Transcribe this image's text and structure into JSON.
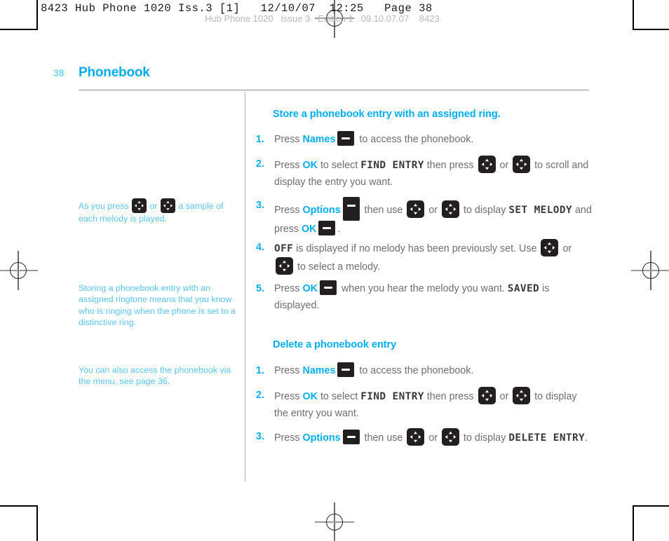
{
  "imposition": {
    "slug": "8423 Hub Phone 1020 Iss.3 [1]   12/10/07  12:25   Page 38",
    "slug_faint": "Hub Phone 1020   Issue 3   Edition 1   09.10.07.07    8423"
  },
  "header": {
    "page_number": "38",
    "title": "Phonebook"
  },
  "sidebar": {
    "notes": [
      {
        "before": "As you press ",
        "icon_a": "nav-key-icon",
        "mid": " or ",
        "icon_b": "nav-key-icon",
        "after": " a sample of each melody is played."
      },
      {
        "text": "Storing a phonebook entry with an assigned ringtone means that you know who is ringing when the phone is set to a distinctive ring."
      },
      {
        "text": "You can also access the phonebook via the menu, see page 36."
      }
    ]
  },
  "main": {
    "sections": [
      {
        "heading": "Store a phonebook entry with an assigned ring.",
        "steps": [
          {
            "num": "1.",
            "parts": [
              {
                "type": "text",
                "value": "Press "
              },
              {
                "type": "blue",
                "value": "Names"
              },
              {
                "type": "key",
                "value": "soft-key-icon"
              },
              {
                "type": "text",
                "value": " to access the phonebook."
              }
            ]
          },
          {
            "num": "2.",
            "parts": [
              {
                "type": "text",
                "value": "Press "
              },
              {
                "type": "blue",
                "value": "OK"
              },
              {
                "type": "text",
                "value": " to select "
              },
              {
                "type": "lcd",
                "value": "FIND ENTRY"
              },
              {
                "type": "text",
                "value": " then press "
              },
              {
                "type": "nav",
                "value": "nav-key-icon"
              },
              {
                "type": "text",
                "value": " or "
              },
              {
                "type": "nav",
                "value": "nav-key-icon"
              },
              {
                "type": "text",
                "value": " to scroll and display the entry you want."
              }
            ]
          },
          {
            "num": "3.",
            "parts": [
              {
                "type": "text",
                "value": "Press "
              },
              {
                "type": "blue",
                "value": "Options"
              },
              {
                "type": "key-tall",
                "value": "soft-key-icon"
              },
              {
                "type": "text",
                "value": " then use "
              },
              {
                "type": "nav",
                "value": "nav-key-icon"
              },
              {
                "type": "text",
                "value": " or "
              },
              {
                "type": "nav",
                "value": "nav-key-icon"
              },
              {
                "type": "text",
                "value": " to display "
              },
              {
                "type": "lcd",
                "value": "SET MELODY"
              },
              {
                "type": "text",
                "value": " and press "
              },
              {
                "type": "blue",
                "value": "OK"
              },
              {
                "type": "key",
                "value": "soft-key-icon"
              },
              {
                "type": "text",
                "value": "."
              }
            ]
          },
          {
            "num": "4.",
            "parts": [
              {
                "type": "lcd",
                "value": "OFF"
              },
              {
                "type": "text",
                "value": " is displayed if no melody has been previously set. Use "
              },
              {
                "type": "nav",
                "value": "nav-key-icon"
              },
              {
                "type": "text",
                "value": " or "
              },
              {
                "type": "nav",
                "value": "nav-key-icon"
              },
              {
                "type": "text",
                "value": " to select a melody."
              }
            ]
          },
          {
            "num": "5.",
            "parts": [
              {
                "type": "text",
                "value": "Press "
              },
              {
                "type": "blue",
                "value": "OK"
              },
              {
                "type": "key",
                "value": "soft-key-icon"
              },
              {
                "type": "text",
                "value": " when you hear the melody you want. "
              },
              {
                "type": "lcd",
                "value": "SAVED"
              },
              {
                "type": "text",
                "value": " is displayed."
              }
            ]
          }
        ]
      },
      {
        "heading": "Delete a phonebook entry",
        "steps": [
          {
            "num": "1.",
            "parts": [
              {
                "type": "text",
                "value": "Press "
              },
              {
                "type": "blue",
                "value": "Names"
              },
              {
                "type": "key",
                "value": "soft-key-icon"
              },
              {
                "type": "text",
                "value": " to access the phonebook."
              }
            ]
          },
          {
            "num": "2.",
            "parts": [
              {
                "type": "text",
                "value": "Press "
              },
              {
                "type": "blue",
                "value": "OK"
              },
              {
                "type": "text",
                "value": " to select "
              },
              {
                "type": "lcd",
                "value": "FIND ENTRY"
              },
              {
                "type": "text",
                "value": " then press "
              },
              {
                "type": "nav",
                "value": "nav-key-icon"
              },
              {
                "type": "text",
                "value": " or "
              },
              {
                "type": "nav",
                "value": "nav-key-icon"
              },
              {
                "type": "text",
                "value": " to display the entry you want."
              }
            ]
          },
          {
            "num": "3.",
            "parts": [
              {
                "type": "text",
                "value": "Press "
              },
              {
                "type": "blue",
                "value": "Options"
              },
              {
                "type": "key",
                "value": "soft-key-icon"
              },
              {
                "type": "text",
                "value": " then use "
              },
              {
                "type": "nav",
                "value": "nav-key-icon"
              },
              {
                "type": "text",
                "value": " or "
              },
              {
                "type": "nav",
                "value": "nav-key-icon"
              },
              {
                "type": "text",
                "value": " to display "
              },
              {
                "type": "lcd",
                "value": "DELETE ENTRY"
              },
              {
                "type": "text",
                "value": "."
              }
            ]
          }
        ]
      }
    ]
  },
  "colors": {
    "accent_blue": "#00aeef",
    "note_blue": "#5ec3ee",
    "body_gray": "#6d6e71",
    "key_black": "#231f20"
  }
}
